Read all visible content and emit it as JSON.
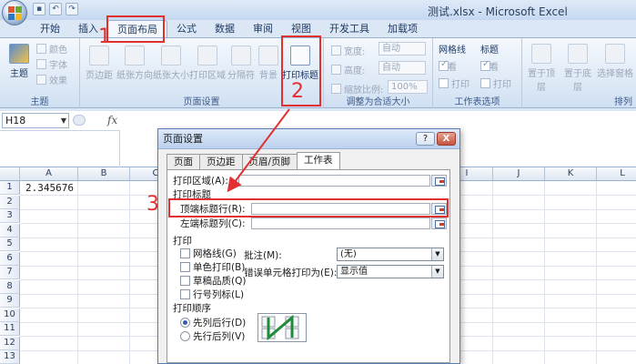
{
  "window": {
    "title": "测试.xlsx - Microsoft Excel"
  },
  "ribbon_tabs": [
    "开始",
    "插入",
    "页面布局",
    "公式",
    "数据",
    "审阅",
    "视图",
    "开发工具",
    "加载项"
  ],
  "ribbon": {
    "theme_group": {
      "label": "主题",
      "theme_btn": "主题",
      "colors": "颜色",
      "fonts": "字体",
      "effects": "效果"
    },
    "page_setup_group": {
      "label": "页面设置",
      "buttons": [
        "页边距",
        "纸张方向",
        "纸张大小",
        "打印区域",
        "分隔符",
        "背景",
        "打印标题"
      ]
    },
    "scale_group": {
      "label": "调整为合适大小",
      "width_label": "宽度:",
      "width_value": "自动",
      "height_label": "高度:",
      "height_value": "自动",
      "scale_label": "缩放比例:",
      "scale_value": "100%"
    },
    "sheet_options_group": {
      "label": "工作表选项",
      "gridlines": "网格线",
      "headings": "标题",
      "view": "查看",
      "print": "打印"
    },
    "arrange_group": {
      "label": "排列",
      "buttons": [
        "置于顶层",
        "置于底层",
        "选择窗格"
      ]
    }
  },
  "formula_bar": {
    "name_box": "H18",
    "fx": "fx",
    "formula": ""
  },
  "grid": {
    "columns": [
      "A",
      "B",
      "C",
      "D",
      "E",
      "F",
      "G",
      "H",
      "I",
      "J",
      "K",
      "L"
    ],
    "rows": [
      "1",
      "2",
      "3",
      "4",
      "5",
      "6",
      "7",
      "8",
      "9",
      "10",
      "11",
      "12",
      "13"
    ],
    "cells": {
      "A1": "2.345676"
    }
  },
  "dialog": {
    "title": "页面设置",
    "help": "?",
    "close": "X",
    "tabs": [
      "页面",
      "页边距",
      "页眉/页脚",
      "工作表"
    ],
    "active_tab": "工作表",
    "print_area_label": "打印区域(A):",
    "print_titles_label": "打印标题",
    "top_rows_label": "顶端标题行(R):",
    "left_cols_label": "左端标题列(C):",
    "print_section": "打印",
    "checkboxes": [
      "网格线(G)",
      "单色打印(B)",
      "草稿品质(Q)",
      "行号列标(L)"
    ],
    "comments_label": "批注(M):",
    "comments_value": "(无)",
    "errors_label": "错误单元格打印为(E):",
    "errors_value": "显示值",
    "order_section": "打印顺序",
    "order_options": [
      "先列后行(D)",
      "先行后列(V)"
    ]
  },
  "annotations": {
    "step1": "1",
    "step2": "2",
    "step3": "3"
  },
  "colors": {
    "highlight": "#e03030",
    "accent": "#2f5fa6"
  }
}
